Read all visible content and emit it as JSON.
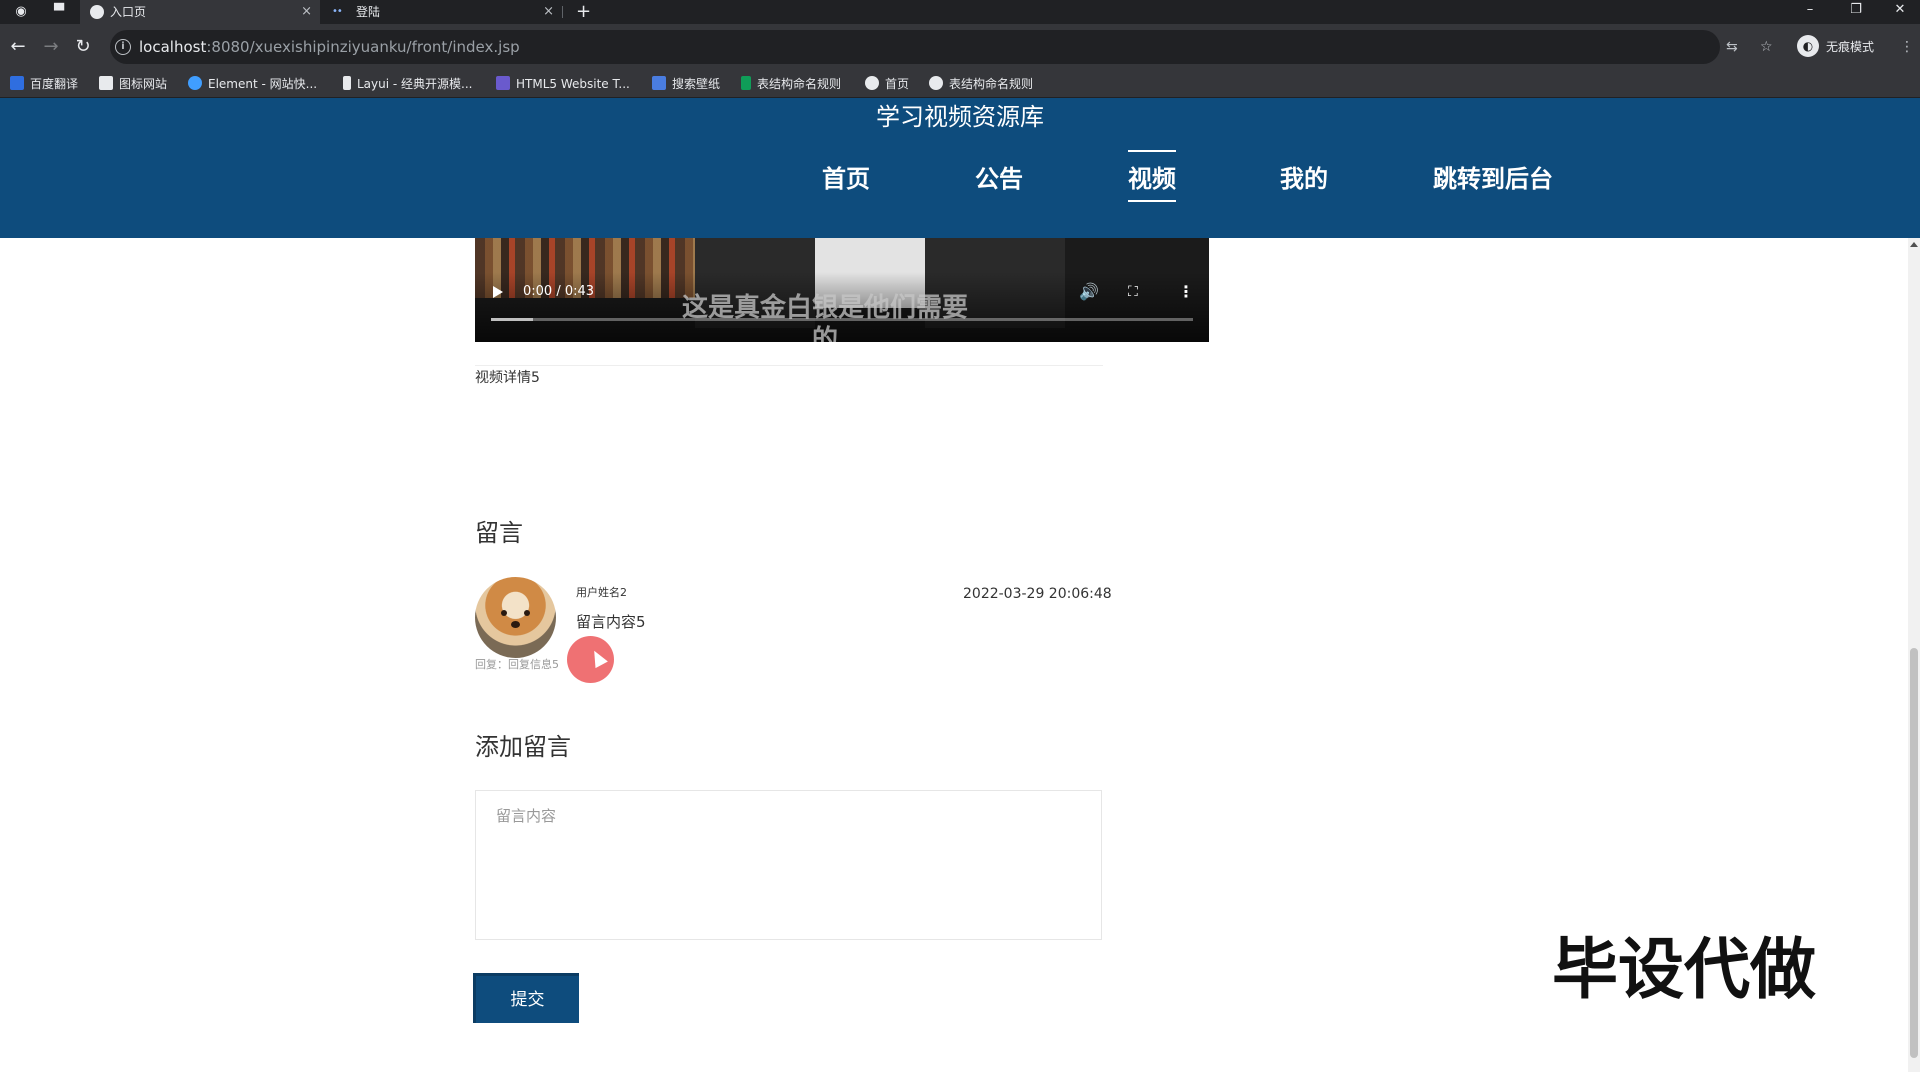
{
  "browser": {
    "tabs": [
      {
        "title": "入口页",
        "active": true
      },
      {
        "title": "登陆",
        "active": false
      }
    ],
    "close_glyph": "×",
    "new_tab_glyph": "+",
    "url_host": "localhost",
    "url_path": ":8080/xuexishipinziyuanku/front/index.jsp",
    "profile_label": "无痕模式",
    "bookmarks": [
      {
        "label": "百度翻译",
        "icon": "baidu-translate-icon",
        "color": "#2f6ee0"
      },
      {
        "label": "图标网站",
        "icon": "flag-icon",
        "color": "#e8eaed"
      },
      {
        "label": "Element - 网站快...",
        "icon": "element-icon",
        "color": "#409eff"
      },
      {
        "label": "Layui - 经典开源模...",
        "icon": "layui-icon",
        "color": "#e8eaed"
      },
      {
        "label": "HTML5 Website T...",
        "icon": "html5-template-icon",
        "color": "#6a5acd"
      },
      {
        "label": "搜索壁纸",
        "icon": "wallpaper-icon",
        "color": "#4a7de0"
      },
      {
        "label": "表结构命名规则",
        "icon": "sheet-icon",
        "color": "#0f9d58"
      },
      {
        "label": "首页",
        "icon": "globe-icon",
        "color": "#e8eaed"
      },
      {
        "label": "表结构命名规则",
        "icon": "globe-icon",
        "color": "#e8eaed"
      }
    ]
  },
  "site": {
    "title": "学习视频资源库",
    "brand_color": "#0e4c7d",
    "menu": [
      {
        "label": "首页",
        "active": false
      },
      {
        "label": "公告",
        "active": false
      },
      {
        "label": "视频",
        "active": true
      },
      {
        "label": "我的",
        "active": false
      },
      {
        "label": "跳转到后台",
        "active": false
      }
    ]
  },
  "video": {
    "time": "0:00 / 0:43",
    "subtitle": "这是真金白银是他们需要的",
    "description": "视频详情5",
    "progress_fraction": 0
  },
  "comments": {
    "section_title": "留言",
    "items": [
      {
        "user": "用户姓名2",
        "time": "2022-03-29 20:06:48",
        "content": "留言内容5",
        "reply": "回复：回复信息5"
      }
    ]
  },
  "add_comment": {
    "title": "添加留言",
    "placeholder": "留言内容",
    "submit_label": "提交"
  },
  "watermark": "毕设代做"
}
